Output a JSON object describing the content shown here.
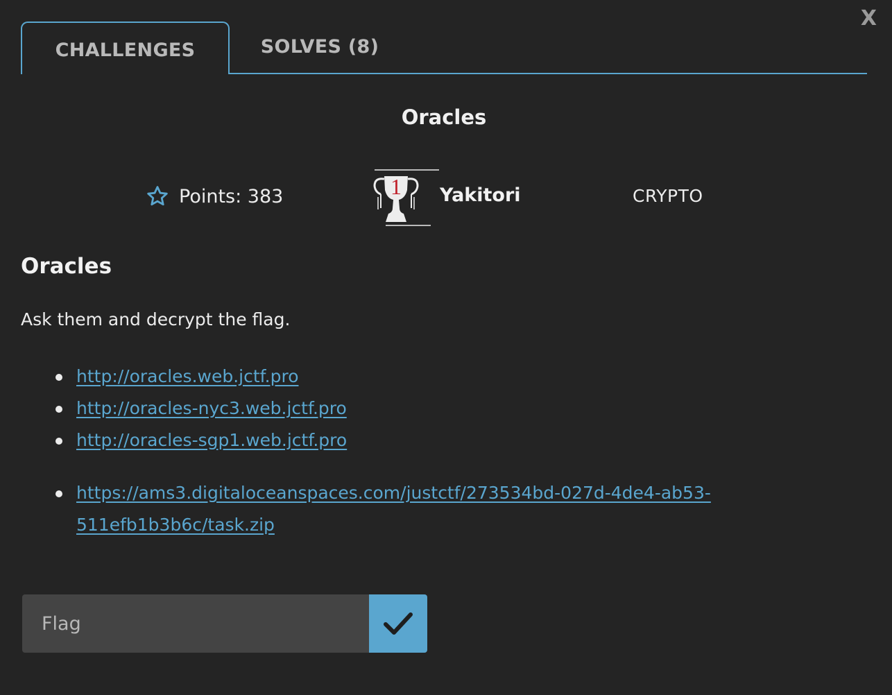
{
  "close_label": "X",
  "tabs": [
    {
      "label": "CHALLENGES",
      "active": true
    },
    {
      "label": "SOLVES (8)",
      "active": false
    }
  ],
  "challenge": {
    "title": "Oracles",
    "points": "Points: 383",
    "first_blood_rank": "1",
    "first_blood_team": "Yakitori",
    "category": "CRYPTO",
    "description_heading": "Oracles",
    "description_text": "Ask them and decrypt the flag.",
    "links": [
      "http://oracles.web.jctf.pro",
      "http://oracles-nyc3.web.jctf.pro",
      "http://oracles-sgp1.web.jctf.pro",
      "https://ams3.digitaloceanspaces.com/justctf/273534bd-027d-4de4-ab53-511efb1b3b6c/task.zip"
    ]
  },
  "flag_form": {
    "placeholder": "Flag",
    "value": ""
  },
  "icons": {
    "points": "star-outline-icon",
    "first_blood": "trophy-icon",
    "submit": "checkmark-icon"
  },
  "colors": {
    "background": "#242424",
    "accent": "#5aa6cf",
    "input_bg": "#444444"
  }
}
